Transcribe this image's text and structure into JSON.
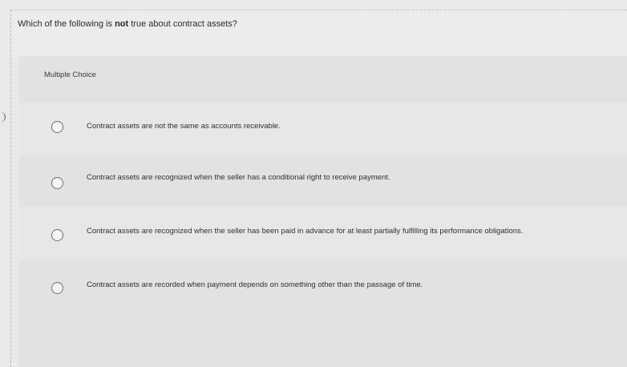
{
  "question": {
    "before": "Which of the following is ",
    "emphasis": "not",
    "after": " true about contract assets?"
  },
  "format_label": "Multiple Choice",
  "options": [
    {
      "label": "Contract assets are not the same as accounts receivable."
    },
    {
      "label": "Contract assets are recognized when the seller has a conditional right to receive payment."
    },
    {
      "label": "Contract assets are recognized when the seller has been paid in advance for at least partially fulfilling its performance obligations."
    },
    {
      "label": "Contract assets are recorded when payment depends on something other than the passage of time."
    }
  ]
}
